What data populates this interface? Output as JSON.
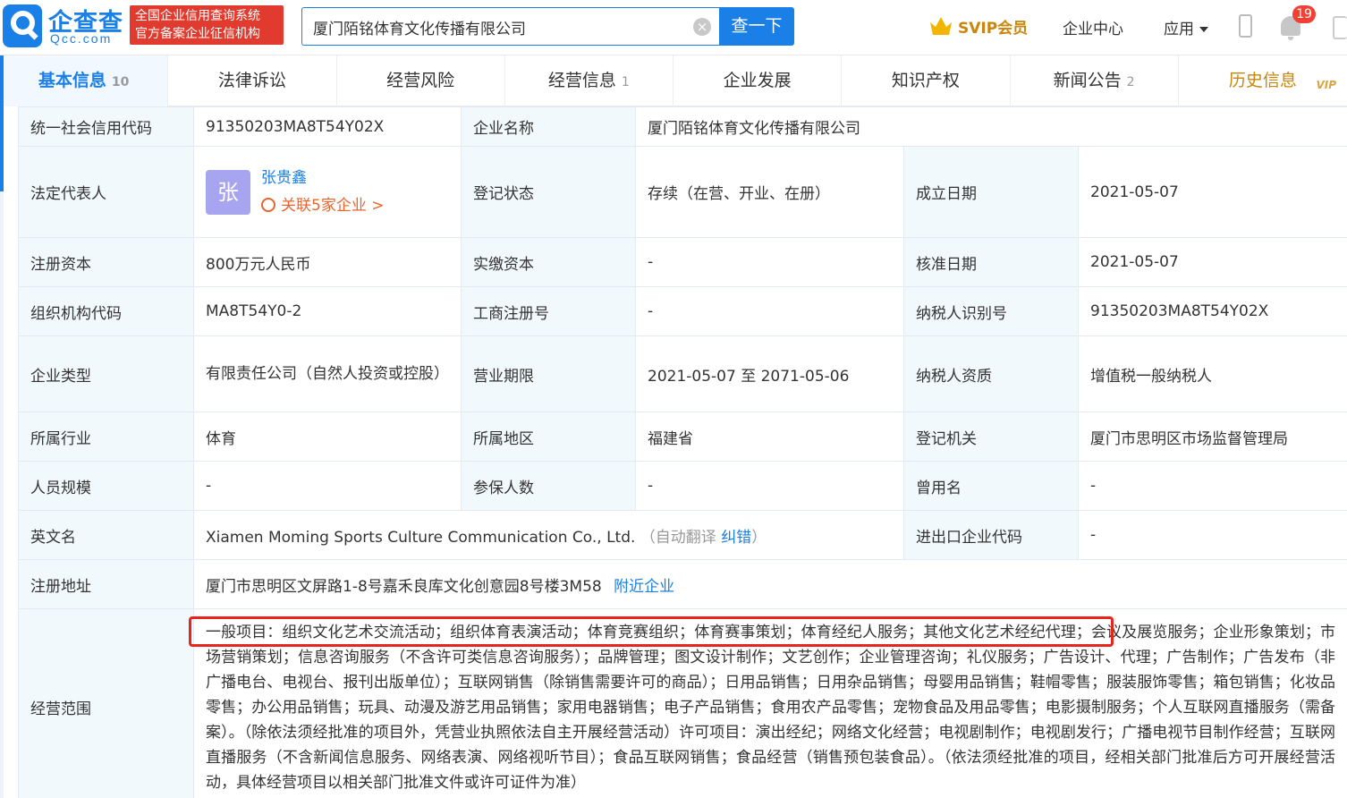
{
  "header": {
    "brand": "企查查",
    "brand_sub": "Qcc.com",
    "seal_line1": "全国企业信用查询系统",
    "seal_line2": "官方备案企业征信机构",
    "search_value": "厦门陌铭体育文化传播有限公司",
    "clear_glyph": "×",
    "search_button": "查一下",
    "svip_label": "SVIP会员",
    "enterprise_center": "企业中心",
    "apps": "应用",
    "notification_count": "19"
  },
  "tabs": [
    {
      "label": "基本信息",
      "count": "10"
    },
    {
      "label": "法律诉讼",
      "count": ""
    },
    {
      "label": "经营风险",
      "count": ""
    },
    {
      "label": "经营信息",
      "count": "1"
    },
    {
      "label": "企业发展",
      "count": ""
    },
    {
      "label": "知识产权",
      "count": ""
    },
    {
      "label": "新闻公告",
      "count": "2"
    },
    {
      "label": "历史信息",
      "count": "",
      "vip": "VIP"
    }
  ],
  "info": {
    "credit_code_label": "统一社会信用代码",
    "credit_code": "91350203MA8T54Y02X",
    "company_name_label": "企业名称",
    "company_name": "厦门陌铭体育文化传播有限公司",
    "legal_rep_label": "法定代表人",
    "legal_rep_avatar": "张",
    "legal_rep_name": "张贵鑫",
    "legal_rep_related": "关联5家企业 >",
    "reg_status_label": "登记状态",
    "reg_status": "存续（在营、开业、在册）",
    "est_date_label": "成立日期",
    "est_date": "2021-05-07",
    "reg_capital_label": "注册资本",
    "reg_capital": "800万元人民币",
    "paid_capital_label": "实缴资本",
    "paid_capital": "-",
    "approval_date_label": "核准日期",
    "approval_date": "2021-05-07",
    "org_code_label": "组织机构代码",
    "org_code": "MA8T54Y0-2",
    "biz_reg_no_label": "工商注册号",
    "biz_reg_no": "-",
    "taxpayer_id_label": "纳税人识别号",
    "taxpayer_id": "91350203MA8T54Y02X",
    "company_type_label": "企业类型",
    "company_type": "有限责任公司（自然人投资或控股）",
    "biz_term_label": "营业期限",
    "biz_term": "2021-05-07 至 2071-05-06",
    "taxpayer_qual_label": "纳税人资质",
    "taxpayer_qual": "增值税一般纳税人",
    "industry_label": "所属行业",
    "industry": "体育",
    "region_label": "所属地区",
    "region": "福建省",
    "reg_authority_label": "登记机关",
    "reg_authority": "厦门市思明区市场监督管理局",
    "staff_size_label": "人员规模",
    "staff_size": "-",
    "insured_label": "参保人数",
    "insured": "-",
    "former_name_label": "曾用名",
    "former_name": "-",
    "english_name_label": "英文名",
    "english_name": "Xiamen Moming Sports Culture Communication Co., Ltd.",
    "auto_translate": "（自动翻译 ",
    "correct_link": "纠错",
    "auto_translate_close": "）",
    "import_export_label": "进出口企业代码",
    "import_export": "-",
    "address_label": "注册地址",
    "address": "厦门市思明区文屏路1-8号嘉禾良库文化创意园8号楼3M58",
    "nearby_link": "附近企业",
    "scope_label": "经营范围",
    "scope": "一般项目：组织文化艺术交流活动；组织体育表演活动；体育竞赛组织；体育赛事策划；体育经纪人服务；其他文化艺术经纪代理；会议及展览服务；企业形象策划；市场营销策划；信息咨询服务（不含许可类信息咨询服务）；品牌管理；图文设计制作；文艺创作；企业管理咨询；礼仪服务；广告设计、代理；广告制作；广告发布（非广播电台、电视台、报刊出版单位）；互联网销售（除销售需要许可的商品）；日用品销售；日用杂品销售；母婴用品销售；鞋帽零售；服装服饰零售；箱包销售；化妆品零售；办公用品销售；玩具、动漫及游艺用品销售；家用电器销售；电子产品销售；食用农产品零售；宠物食品及用品零售；电影摄制服务；个人互联网直播服务（需备案）。（除依法须经批准的项目外，凭营业执照依法自主开展经营活动）许可项目：演出经纪；网络文化经营；电视剧制作；电视剧发行；广播电视节目制作经营；互联网直播服务（不含新闻信息服务、网络表演、网络视听节目）；食品互联网销售；食品经营（销售预包装食品）。（依法须经批准的项目，经相关部门批准后方可开展经营活动，具体经营项目以相关部门批准文件或许可证件为准）"
  },
  "colors": {
    "brand_blue": "#1a7fe6",
    "label_bg": "#f2f9fc",
    "highlight_red": "#e8241c"
  }
}
